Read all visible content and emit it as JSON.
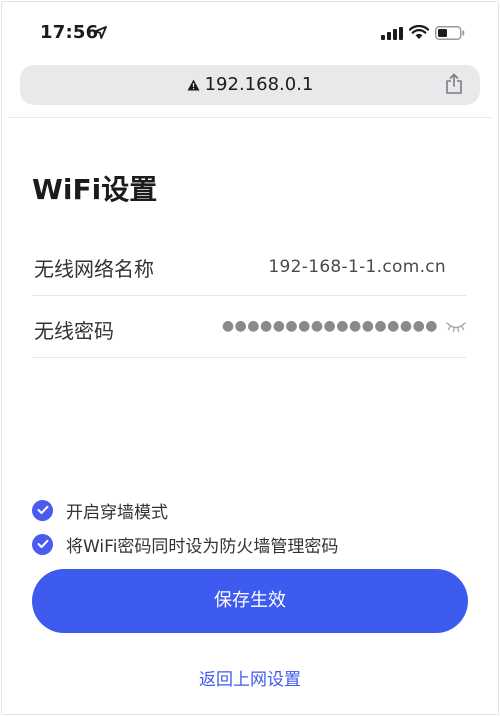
{
  "status_bar": {
    "time": "17:56",
    "icons": [
      "location-arrow-icon",
      "cellular-signal-icon",
      "wifi-icon",
      "battery-icon"
    ]
  },
  "browser": {
    "url": "192.168.0.1",
    "warning_icon": "warning-triangle-icon",
    "share_icon": "share-icon"
  },
  "page": {
    "title": "WiFi设置",
    "wifi_name": {
      "label": "无线网络名称",
      "value": "192-168-1-1.com.cn"
    },
    "wifi_password": {
      "label": "无线密码",
      "value_masked": "●●●●●●●●●●●●●●●●●",
      "toggle_icon": "eye-closed-icon"
    },
    "options": [
      {
        "label": "开启穿墙模式",
        "checked": true
      },
      {
        "label": "将WiFi密码同时设为防火墙管理密码",
        "checked": true
      }
    ],
    "save_button": "保存生效",
    "back_link": "返回上网设置"
  },
  "colors": {
    "accent": "#3e5bef",
    "checkbox": "#4a5cf0",
    "url_bar_bg": "#e9e9eb",
    "text": "#1c1c1e"
  }
}
